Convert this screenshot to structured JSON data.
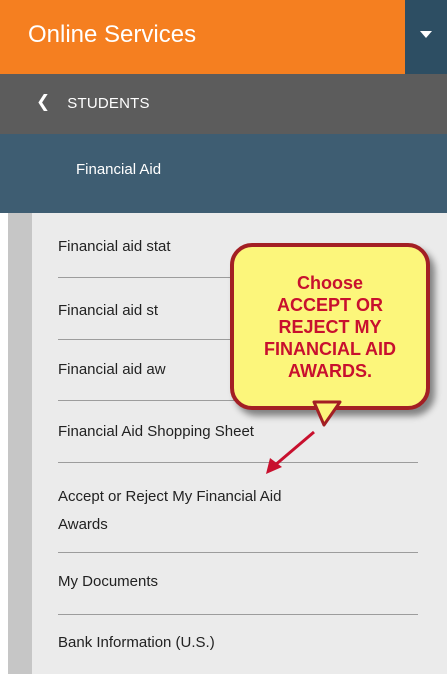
{
  "header": {
    "title": "Online Services",
    "toggle_icon": "triangle-down-icon"
  },
  "breadcrumb": {
    "back_icon": "chevron-left-icon",
    "label": "STUDENTS"
  },
  "section": {
    "title": "Financial Aid"
  },
  "menu": {
    "items": [
      {
        "line1": "Financial aid stat",
        "line2": ""
      },
      {
        "line1": "Financial aid st",
        "line2": ""
      },
      {
        "line1": "Financial aid aw",
        "line2": ""
      },
      {
        "line1": "Financial Aid Shopping Sheet",
        "line2": ""
      },
      {
        "line1": "Accept or Reject My Financial Aid",
        "line2": "Awards"
      },
      {
        "line1": "My Documents",
        "line2": ""
      },
      {
        "line1": "Bank Information (U.S.)",
        "line2": ""
      }
    ]
  },
  "callout": {
    "text": "Choose\nACCEPT OR\nREJECT MY\nFINANCIAL AID\nAWARDS."
  },
  "colors": {
    "orange": "#f57f20",
    "navy": "#2d4e63",
    "dark_gray": "#5c5c5c",
    "section_blue": "#3e5d72",
    "list_bg": "#ebebeb",
    "callout_bg": "#fcf67b",
    "callout_red": "#c8102e"
  }
}
